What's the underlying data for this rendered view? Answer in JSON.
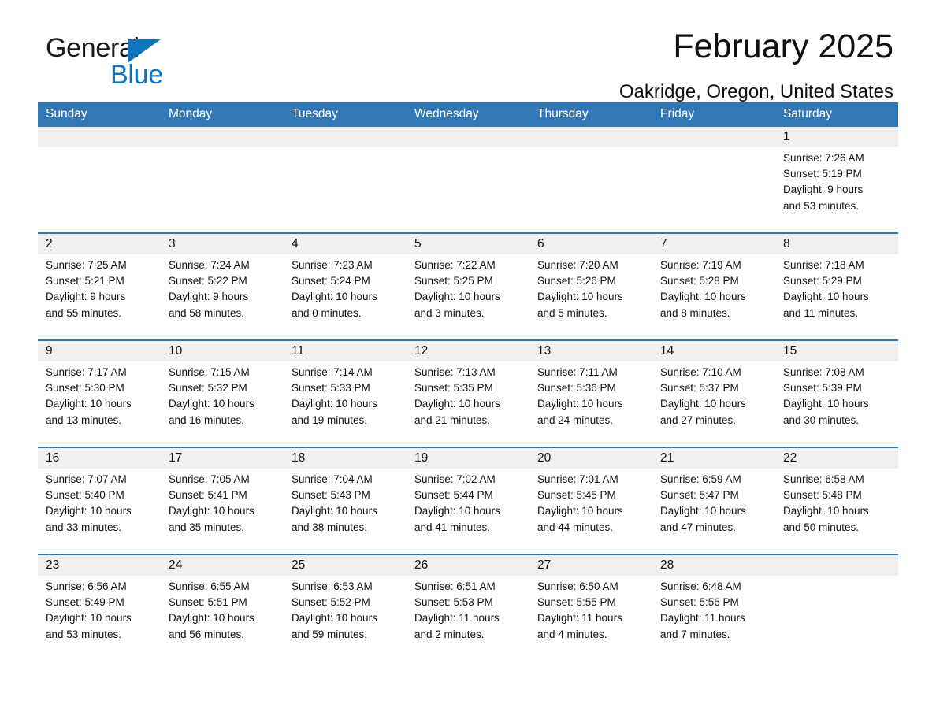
{
  "brand": {
    "name_part1": "General",
    "name_part2": "Blue",
    "accent_color": "#1273bd"
  },
  "header": {
    "title": "February 2025",
    "subtitle": "Oakridge, Oregon, United States"
  },
  "theme": {
    "header_row_color": "#3277b6",
    "rule_color": "#2e74b5",
    "daynum_band_color": "#f0f0f0"
  },
  "calendar": {
    "weekdays": [
      "Sunday",
      "Monday",
      "Tuesday",
      "Wednesday",
      "Thursday",
      "Friday",
      "Saturday"
    ],
    "weeks": [
      [
        {
          "day": "",
          "info": ""
        },
        {
          "day": "",
          "info": ""
        },
        {
          "day": "",
          "info": ""
        },
        {
          "day": "",
          "info": ""
        },
        {
          "day": "",
          "info": ""
        },
        {
          "day": "",
          "info": ""
        },
        {
          "day": "1",
          "info": "Sunrise: 7:26 AM\nSunset: 5:19 PM\nDaylight: 9 hours\nand 53 minutes."
        }
      ],
      [
        {
          "day": "2",
          "info": "Sunrise: 7:25 AM\nSunset: 5:21 PM\nDaylight: 9 hours\nand 55 minutes."
        },
        {
          "day": "3",
          "info": "Sunrise: 7:24 AM\nSunset: 5:22 PM\nDaylight: 9 hours\nand 58 minutes."
        },
        {
          "day": "4",
          "info": "Sunrise: 7:23 AM\nSunset: 5:24 PM\nDaylight: 10 hours\nand 0 minutes."
        },
        {
          "day": "5",
          "info": "Sunrise: 7:22 AM\nSunset: 5:25 PM\nDaylight: 10 hours\nand 3 minutes."
        },
        {
          "day": "6",
          "info": "Sunrise: 7:20 AM\nSunset: 5:26 PM\nDaylight: 10 hours\nand 5 minutes."
        },
        {
          "day": "7",
          "info": "Sunrise: 7:19 AM\nSunset: 5:28 PM\nDaylight: 10 hours\nand 8 minutes."
        },
        {
          "day": "8",
          "info": "Sunrise: 7:18 AM\nSunset: 5:29 PM\nDaylight: 10 hours\nand 11 minutes."
        }
      ],
      [
        {
          "day": "9",
          "info": "Sunrise: 7:17 AM\nSunset: 5:30 PM\nDaylight: 10 hours\nand 13 minutes."
        },
        {
          "day": "10",
          "info": "Sunrise: 7:15 AM\nSunset: 5:32 PM\nDaylight: 10 hours\nand 16 minutes."
        },
        {
          "day": "11",
          "info": "Sunrise: 7:14 AM\nSunset: 5:33 PM\nDaylight: 10 hours\nand 19 minutes."
        },
        {
          "day": "12",
          "info": "Sunrise: 7:13 AM\nSunset: 5:35 PM\nDaylight: 10 hours\nand 21 minutes."
        },
        {
          "day": "13",
          "info": "Sunrise: 7:11 AM\nSunset: 5:36 PM\nDaylight: 10 hours\nand 24 minutes."
        },
        {
          "day": "14",
          "info": "Sunrise: 7:10 AM\nSunset: 5:37 PM\nDaylight: 10 hours\nand 27 minutes."
        },
        {
          "day": "15",
          "info": "Sunrise: 7:08 AM\nSunset: 5:39 PM\nDaylight: 10 hours\nand 30 minutes."
        }
      ],
      [
        {
          "day": "16",
          "info": "Sunrise: 7:07 AM\nSunset: 5:40 PM\nDaylight: 10 hours\nand 33 minutes."
        },
        {
          "day": "17",
          "info": "Sunrise: 7:05 AM\nSunset: 5:41 PM\nDaylight: 10 hours\nand 35 minutes."
        },
        {
          "day": "18",
          "info": "Sunrise: 7:04 AM\nSunset: 5:43 PM\nDaylight: 10 hours\nand 38 minutes."
        },
        {
          "day": "19",
          "info": "Sunrise: 7:02 AM\nSunset: 5:44 PM\nDaylight: 10 hours\nand 41 minutes."
        },
        {
          "day": "20",
          "info": "Sunrise: 7:01 AM\nSunset: 5:45 PM\nDaylight: 10 hours\nand 44 minutes."
        },
        {
          "day": "21",
          "info": "Sunrise: 6:59 AM\nSunset: 5:47 PM\nDaylight: 10 hours\nand 47 minutes."
        },
        {
          "day": "22",
          "info": "Sunrise: 6:58 AM\nSunset: 5:48 PM\nDaylight: 10 hours\nand 50 minutes."
        }
      ],
      [
        {
          "day": "23",
          "info": "Sunrise: 6:56 AM\nSunset: 5:49 PM\nDaylight: 10 hours\nand 53 minutes."
        },
        {
          "day": "24",
          "info": "Sunrise: 6:55 AM\nSunset: 5:51 PM\nDaylight: 10 hours\nand 56 minutes."
        },
        {
          "day": "25",
          "info": "Sunrise: 6:53 AM\nSunset: 5:52 PM\nDaylight: 10 hours\nand 59 minutes."
        },
        {
          "day": "26",
          "info": "Sunrise: 6:51 AM\nSunset: 5:53 PM\nDaylight: 11 hours\nand 2 minutes."
        },
        {
          "day": "27",
          "info": "Sunrise: 6:50 AM\nSunset: 5:55 PM\nDaylight: 11 hours\nand 4 minutes."
        },
        {
          "day": "28",
          "info": "Sunrise: 6:48 AM\nSunset: 5:56 PM\nDaylight: 11 hours\nand 7 minutes."
        },
        {
          "day": "",
          "info": ""
        }
      ]
    ]
  }
}
